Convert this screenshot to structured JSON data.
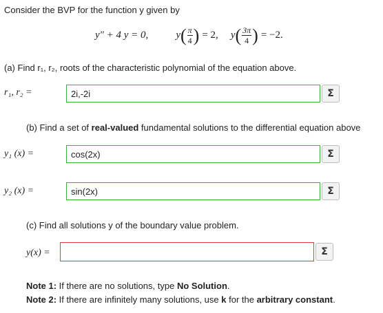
{
  "intro": "Consider the BVP for the function y given by",
  "equation": {
    "ode": "y″ + 4 y = 0,",
    "bc1_lhs": "y",
    "bc1_num": "π",
    "bc1_den": "4",
    "bc1_rhs": "= 2,",
    "bc2_lhs": "y",
    "bc2_num": "3π",
    "bc2_den": "4",
    "bc2_rhs": "= −2."
  },
  "part_a": {
    "prompt": "(a) Find r₁, r₂, roots of the characteristic polynomial of the equation above.",
    "label": "r₁, r₂ =",
    "value": "2i,-2i"
  },
  "part_b": {
    "prompt_pre": "(b) Find a set of ",
    "prompt_bold": "real-valued",
    "prompt_post": " fundamental solutions to the differential equation above",
    "y1_label": "y₁ (x) =",
    "y1_value": "cos(2x)",
    "y2_label": "y₂ (x) =",
    "y2_value": "sin(2x)"
  },
  "part_c": {
    "prompt": "(c) Find all solutions y of the boundary value problem.",
    "label": "y(x) =",
    "value": ""
  },
  "notes": {
    "note1_label": "Note 1:",
    "note1_pre": " If there are no solutions, type ",
    "note1_bold": "No Solution",
    "note1_post": ".",
    "note2_label": "Note 2:",
    "note2_pre": " If there are infinitely many solutions, use ",
    "note2_bold": "k",
    "note2_mid": " for the ",
    "note2_bold2": "arbitrary constant",
    "note2_post": "."
  },
  "sigma_symbol": "Σ",
  "colors": {
    "correct_border": "#3cae3c",
    "error_border": "#e23b3b"
  }
}
